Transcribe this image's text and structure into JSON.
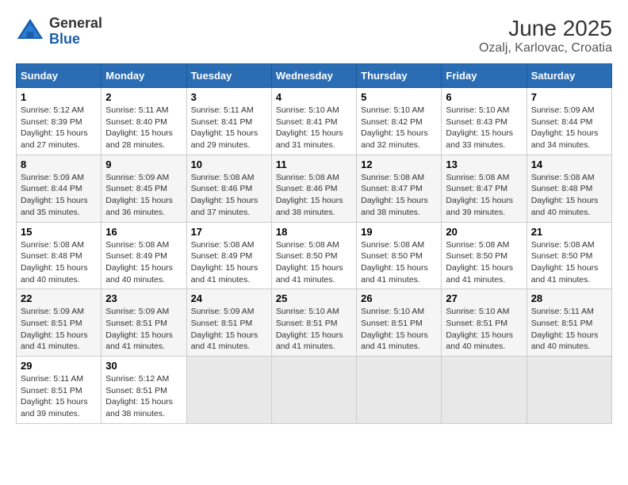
{
  "header": {
    "logo_general": "General",
    "logo_blue": "Blue",
    "title": "June 2025",
    "subtitle": "Ozalj, Karlovac, Croatia"
  },
  "days_of_week": [
    "Sunday",
    "Monday",
    "Tuesday",
    "Wednesday",
    "Thursday",
    "Friday",
    "Saturday"
  ],
  "weeks": [
    {
      "days": [
        {
          "num": "1",
          "info": "Sunrise: 5:12 AM\nSunset: 8:39 PM\nDaylight: 15 hours\nand 27 minutes."
        },
        {
          "num": "2",
          "info": "Sunrise: 5:11 AM\nSunset: 8:40 PM\nDaylight: 15 hours\nand 28 minutes."
        },
        {
          "num": "3",
          "info": "Sunrise: 5:11 AM\nSunset: 8:41 PM\nDaylight: 15 hours\nand 29 minutes."
        },
        {
          "num": "4",
          "info": "Sunrise: 5:10 AM\nSunset: 8:41 PM\nDaylight: 15 hours\nand 31 minutes."
        },
        {
          "num": "5",
          "info": "Sunrise: 5:10 AM\nSunset: 8:42 PM\nDaylight: 15 hours\nand 32 minutes."
        },
        {
          "num": "6",
          "info": "Sunrise: 5:10 AM\nSunset: 8:43 PM\nDaylight: 15 hours\nand 33 minutes."
        },
        {
          "num": "7",
          "info": "Sunrise: 5:09 AM\nSunset: 8:44 PM\nDaylight: 15 hours\nand 34 minutes."
        }
      ]
    },
    {
      "days": [
        {
          "num": "8",
          "info": "Sunrise: 5:09 AM\nSunset: 8:44 PM\nDaylight: 15 hours\nand 35 minutes."
        },
        {
          "num": "9",
          "info": "Sunrise: 5:09 AM\nSunset: 8:45 PM\nDaylight: 15 hours\nand 36 minutes."
        },
        {
          "num": "10",
          "info": "Sunrise: 5:08 AM\nSunset: 8:46 PM\nDaylight: 15 hours\nand 37 minutes."
        },
        {
          "num": "11",
          "info": "Sunrise: 5:08 AM\nSunset: 8:46 PM\nDaylight: 15 hours\nand 38 minutes."
        },
        {
          "num": "12",
          "info": "Sunrise: 5:08 AM\nSunset: 8:47 PM\nDaylight: 15 hours\nand 38 minutes."
        },
        {
          "num": "13",
          "info": "Sunrise: 5:08 AM\nSunset: 8:47 PM\nDaylight: 15 hours\nand 39 minutes."
        },
        {
          "num": "14",
          "info": "Sunrise: 5:08 AM\nSunset: 8:48 PM\nDaylight: 15 hours\nand 40 minutes."
        }
      ]
    },
    {
      "days": [
        {
          "num": "15",
          "info": "Sunrise: 5:08 AM\nSunset: 8:48 PM\nDaylight: 15 hours\nand 40 minutes."
        },
        {
          "num": "16",
          "info": "Sunrise: 5:08 AM\nSunset: 8:49 PM\nDaylight: 15 hours\nand 40 minutes."
        },
        {
          "num": "17",
          "info": "Sunrise: 5:08 AM\nSunset: 8:49 PM\nDaylight: 15 hours\nand 41 minutes."
        },
        {
          "num": "18",
          "info": "Sunrise: 5:08 AM\nSunset: 8:50 PM\nDaylight: 15 hours\nand 41 minutes."
        },
        {
          "num": "19",
          "info": "Sunrise: 5:08 AM\nSunset: 8:50 PM\nDaylight: 15 hours\nand 41 minutes."
        },
        {
          "num": "20",
          "info": "Sunrise: 5:08 AM\nSunset: 8:50 PM\nDaylight: 15 hours\nand 41 minutes."
        },
        {
          "num": "21",
          "info": "Sunrise: 5:08 AM\nSunset: 8:50 PM\nDaylight: 15 hours\nand 41 minutes."
        }
      ]
    },
    {
      "days": [
        {
          "num": "22",
          "info": "Sunrise: 5:09 AM\nSunset: 8:51 PM\nDaylight: 15 hours\nand 41 minutes."
        },
        {
          "num": "23",
          "info": "Sunrise: 5:09 AM\nSunset: 8:51 PM\nDaylight: 15 hours\nand 41 minutes."
        },
        {
          "num": "24",
          "info": "Sunrise: 5:09 AM\nSunset: 8:51 PM\nDaylight: 15 hours\nand 41 minutes."
        },
        {
          "num": "25",
          "info": "Sunrise: 5:10 AM\nSunset: 8:51 PM\nDaylight: 15 hours\nand 41 minutes."
        },
        {
          "num": "26",
          "info": "Sunrise: 5:10 AM\nSunset: 8:51 PM\nDaylight: 15 hours\nand 41 minutes."
        },
        {
          "num": "27",
          "info": "Sunrise: 5:10 AM\nSunset: 8:51 PM\nDaylight: 15 hours\nand 40 minutes."
        },
        {
          "num": "28",
          "info": "Sunrise: 5:11 AM\nSunset: 8:51 PM\nDaylight: 15 hours\nand 40 minutes."
        }
      ]
    },
    {
      "days": [
        {
          "num": "29",
          "info": "Sunrise: 5:11 AM\nSunset: 8:51 PM\nDaylight: 15 hours\nand 39 minutes."
        },
        {
          "num": "30",
          "info": "Sunrise: 5:12 AM\nSunset: 8:51 PM\nDaylight: 15 hours\nand 38 minutes."
        },
        {
          "num": "",
          "info": ""
        },
        {
          "num": "",
          "info": ""
        },
        {
          "num": "",
          "info": ""
        },
        {
          "num": "",
          "info": ""
        },
        {
          "num": "",
          "info": ""
        }
      ]
    }
  ]
}
